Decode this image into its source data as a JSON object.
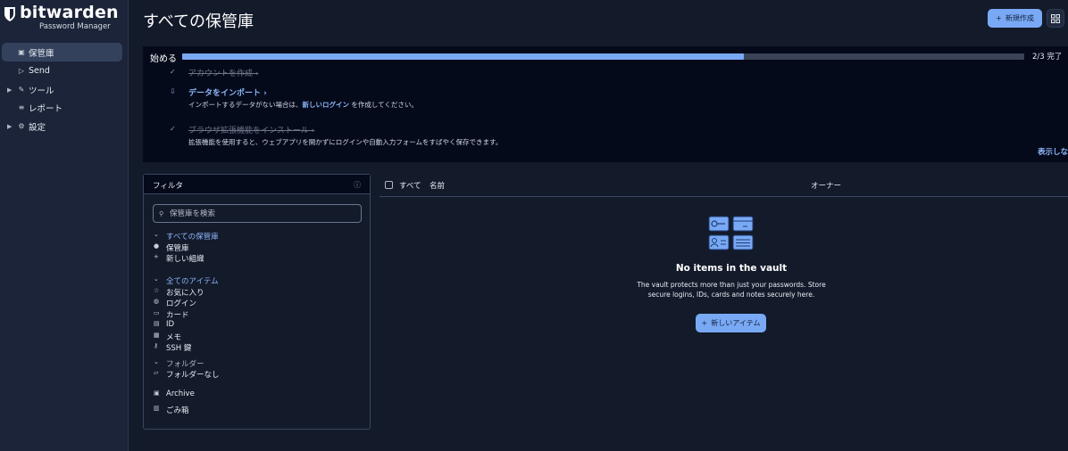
{
  "brand": {
    "name": "bitwarden",
    "product": "Password Manager"
  },
  "sidebar": {
    "items": [
      {
        "label": "保管庫",
        "icon": "vault-icon",
        "active": true,
        "expandable": false
      },
      {
        "label": "Send",
        "icon": "send-icon",
        "active": false,
        "expandable": false
      },
      {
        "label": "ツール",
        "icon": "wrench-icon",
        "active": false,
        "expandable": true
      },
      {
        "label": "レポート",
        "icon": "report-icon",
        "active": false,
        "expandable": false
      },
      {
        "label": "設定",
        "icon": "gear-icon",
        "active": false,
        "expandable": true
      }
    ]
  },
  "header": {
    "title": "すべての保管庫",
    "new_button": "新規作成",
    "apps_icon": "grid-icon"
  },
  "setup": {
    "title": "始める",
    "progress_fraction": 0.667,
    "progress_text": "2/3 完了",
    "steps": [
      {
        "title": "アカウントを作成",
        "done": true,
        "description": ""
      },
      {
        "title": "データをインポート",
        "done": false,
        "description_before": "インポートするデータがない場合は、",
        "description_link": "新しいログイン",
        "description_after": " を作成してください。"
      },
      {
        "title": "ブラウザ拡張機能をインストール",
        "done": true,
        "description": "拡張機能を使用すると、ウェブアプリを開かずにログインや自動入力フォームをすばやく保存できます。"
      }
    ],
    "hide_link": "表示しな"
  },
  "filter": {
    "title": "フィルタ",
    "search_placeholder": "保管庫を検索",
    "vaults_header": "すべての保管庫",
    "vaults": [
      "保管庫",
      "新しい組織"
    ],
    "types_header": "全てのアイテム",
    "types": [
      "お気に入り",
      "ログイン",
      "カード",
      "ID",
      "メモ",
      "SSH 鍵"
    ],
    "folders_header": "フォルダー",
    "folders": [
      "フォルダーなし"
    ],
    "archive": "Archive",
    "trash": "ごみ箱"
  },
  "list": {
    "select_all": "すべて",
    "col_name": "名前",
    "col_owner": "オーナー",
    "empty_title": "No items in the vault",
    "empty_desc_1": "The vault protects more than just your passwords. Store",
    "empty_desc_2": "secure logins, IDs, cards and notes securely here.",
    "new_item_button": "新しいアイテム"
  },
  "colors": {
    "accent": "#79a9f5",
    "link": "#8db5f7",
    "sidebar_bg": "#1b2438",
    "panel_bg": "#040a1a"
  }
}
